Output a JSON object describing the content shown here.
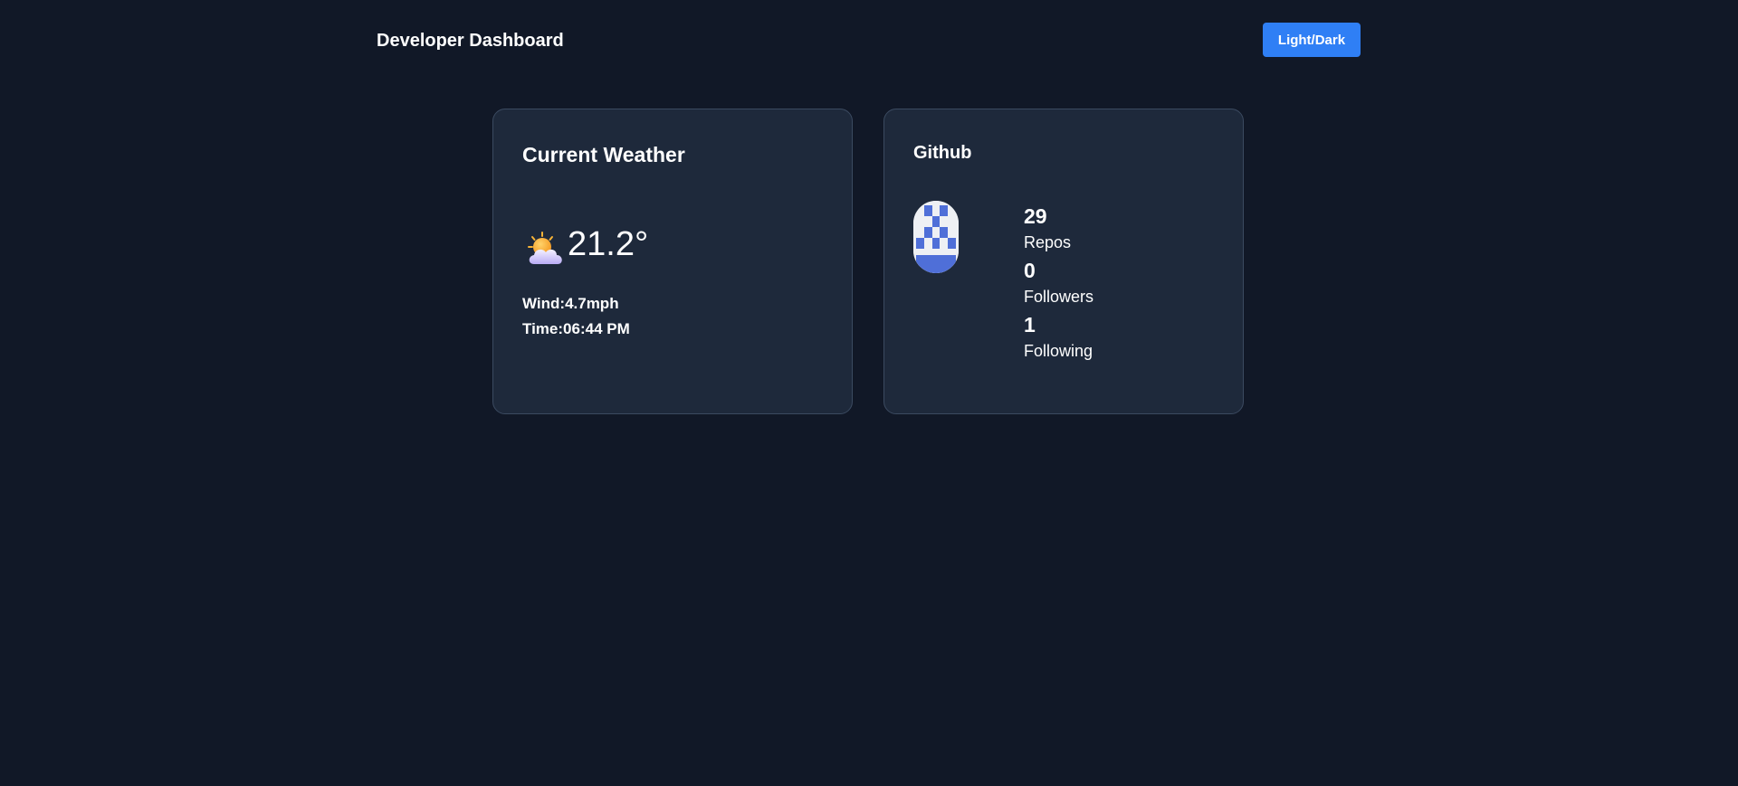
{
  "header": {
    "title": "Developer Dashboard",
    "theme_toggle_label": "Light/Dark"
  },
  "weather": {
    "title": "Current Weather",
    "icon": "partly-cloudy-icon",
    "temperature": "21.2°",
    "wind_label": "Wind:",
    "wind_value": "4.7mph",
    "time_label": "Time:",
    "time_value": "06:44 PM"
  },
  "github": {
    "title": "Github",
    "avatar_icon": "identicon-avatar",
    "stats": [
      {
        "value": "29",
        "label": "Repos"
      },
      {
        "value": "0",
        "label": "Followers"
      },
      {
        "value": "1",
        "label": "Following"
      }
    ]
  },
  "colors": {
    "background": "#111827",
    "card": "#1e293b",
    "card_border": "#3b4a60",
    "accent": "#2f7ff5",
    "avatar_pattern": "#4f6fd8"
  }
}
